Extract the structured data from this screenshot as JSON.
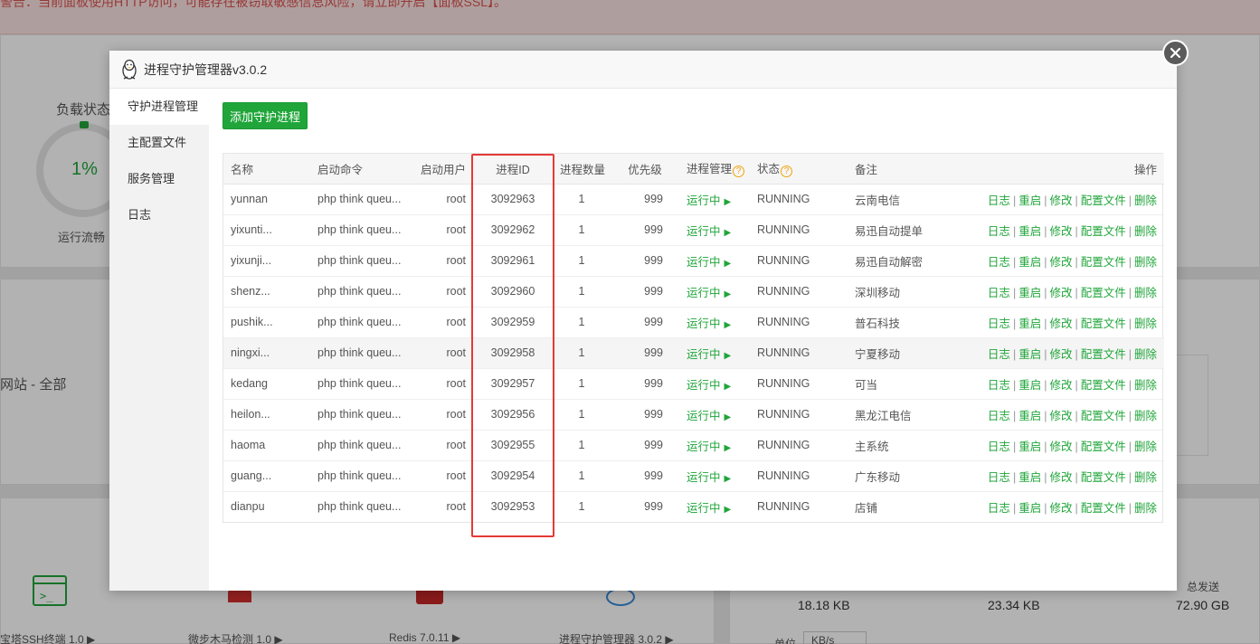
{
  "background": {
    "banner_text": "警告：当前面板使用HTTP访问，可能存在被窃取敏感信息风险，请立即开启【面板SSL】。",
    "load_title": "负载状态",
    "load_value": "1%",
    "load_status": "运行流畅",
    "site_label": "网站 - 全部",
    "apps": [
      {
        "label": "宝塔SSH终端 1.0 ▶"
      },
      {
        "label": "微步木马检测 1.0 ▶"
      },
      {
        "label": "Redis 7.0.11 ▶"
      },
      {
        "label": "进程守护管理器 3.0.2 ▶"
      }
    ],
    "traffic": {
      "sent_label": "总发送",
      "v1": "18.18 KB",
      "v2": "23.34 KB",
      "v3": "72.90 GB",
      "unit_label": "单位",
      "unit_value": "KB/s"
    }
  },
  "modal": {
    "title": "进程守护管理器v3.0.2",
    "sidebar": [
      {
        "label": "守护进程管理"
      },
      {
        "label": "主配置文件"
      },
      {
        "label": "服务管理"
      },
      {
        "label": "日志"
      }
    ],
    "add_button": "添加守护进程",
    "columns": {
      "name": "名称",
      "cmd": "启动命令",
      "user": "启动用户",
      "pid": "进程ID",
      "count": "进程数量",
      "priority": "优先级",
      "manage": "进程管理",
      "status": "状态",
      "note": "备注",
      "ops": "操作"
    },
    "help_glyph": "?",
    "ops": {
      "log": "日志",
      "restart": "重启",
      "edit": "修改",
      "config": "配置文件",
      "delete": "删除",
      "sep": "|"
    },
    "rows": [
      {
        "name": "yunnan",
        "cmd": "php think queu...",
        "user": "root",
        "pid": "3092963",
        "count": "1",
        "priority": "999",
        "manage": "运行中",
        "status": "RUNNING",
        "note": "云南电信"
      },
      {
        "name": "yixunti...",
        "cmd": "php think queu...",
        "user": "root",
        "pid": "3092962",
        "count": "1",
        "priority": "999",
        "manage": "运行中",
        "status": "RUNNING",
        "note": "易迅自动提单"
      },
      {
        "name": "yixunji...",
        "cmd": "php think queu...",
        "user": "root",
        "pid": "3092961",
        "count": "1",
        "priority": "999",
        "manage": "运行中",
        "status": "RUNNING",
        "note": "易迅自动解密"
      },
      {
        "name": "shenz...",
        "cmd": "php think queu...",
        "user": "root",
        "pid": "3092960",
        "count": "1",
        "priority": "999",
        "manage": "运行中",
        "status": "RUNNING",
        "note": "深圳移动"
      },
      {
        "name": "pushik...",
        "cmd": "php think queu...",
        "user": "root",
        "pid": "3092959",
        "count": "1",
        "priority": "999",
        "manage": "运行中",
        "status": "RUNNING",
        "note": "普石科技"
      },
      {
        "name": "ningxi...",
        "cmd": "php think queu...",
        "user": "root",
        "pid": "3092958",
        "count": "1",
        "priority": "999",
        "manage": "运行中",
        "status": "RUNNING",
        "note": "宁夏移动"
      },
      {
        "name": "kedang",
        "cmd": "php think queu...",
        "user": "root",
        "pid": "3092957",
        "count": "1",
        "priority": "999",
        "manage": "运行中",
        "status": "RUNNING",
        "note": "可当"
      },
      {
        "name": "heilon...",
        "cmd": "php think queu...",
        "user": "root",
        "pid": "3092956",
        "count": "1",
        "priority": "999",
        "manage": "运行中",
        "status": "RUNNING",
        "note": "黑龙江电信"
      },
      {
        "name": "haoma",
        "cmd": "php think queu...",
        "user": "root",
        "pid": "3092955",
        "count": "1",
        "priority": "999",
        "manage": "运行中",
        "status": "RUNNING",
        "note": "主系统"
      },
      {
        "name": "guang...",
        "cmd": "php think queu...",
        "user": "root",
        "pid": "3092954",
        "count": "1",
        "priority": "999",
        "manage": "运行中",
        "status": "RUNNING",
        "note": "广东移动"
      },
      {
        "name": "dianpu",
        "cmd": "php think queu...",
        "user": "root",
        "pid": "3092953",
        "count": "1",
        "priority": "999",
        "manage": "运行中",
        "status": "RUNNING",
        "note": "店铺"
      }
    ]
  },
  "colors": {
    "accent": "#20a53a",
    "highlight": "#e53935",
    "help": "#f0a30a"
  }
}
